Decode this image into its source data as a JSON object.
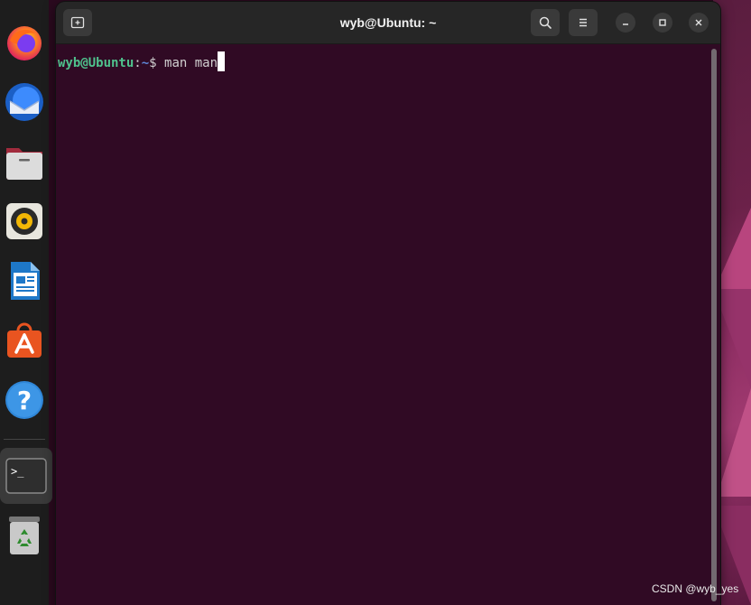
{
  "window": {
    "title": "wyb@Ubuntu: ~",
    "new_tab_icon": "new-tab-icon",
    "search_icon": "search-icon",
    "menu_icon": "hamburger-menu-icon",
    "minimize_icon": "minimize-icon",
    "maximize_icon": "maximize-icon",
    "close_icon": "close-icon"
  },
  "terminal": {
    "user_host": "wyb@Ubuntu",
    "colon": ":",
    "path": "~",
    "prompt_symbol": "$ ",
    "command": "man man"
  },
  "dock": {
    "items": [
      {
        "name": "Firefox",
        "icon": "firefox-icon"
      },
      {
        "name": "Thunderbird",
        "icon": "thunderbird-icon"
      },
      {
        "name": "Files",
        "icon": "files-icon"
      },
      {
        "name": "Rhythmbox",
        "icon": "rhythmbox-icon"
      },
      {
        "name": "LibreOffice Writer",
        "icon": "libreoffice-writer-icon"
      },
      {
        "name": "Ubuntu Software",
        "icon": "ubuntu-software-icon"
      },
      {
        "name": "Help",
        "icon": "help-icon"
      },
      {
        "name": "Terminal",
        "icon": "terminal-icon"
      },
      {
        "name": "Trash",
        "icon": "trash-icon"
      }
    ],
    "terminal_glyph": ">_",
    "help_glyph": "?"
  },
  "colors": {
    "terminal_bg": "#300a24",
    "prompt_user": "#4fc28d",
    "prompt_path": "#5f87d7",
    "titlebar": "#262626",
    "dock_bg": "#1d1d1d"
  },
  "watermark": "CSDN @wyb_yes"
}
